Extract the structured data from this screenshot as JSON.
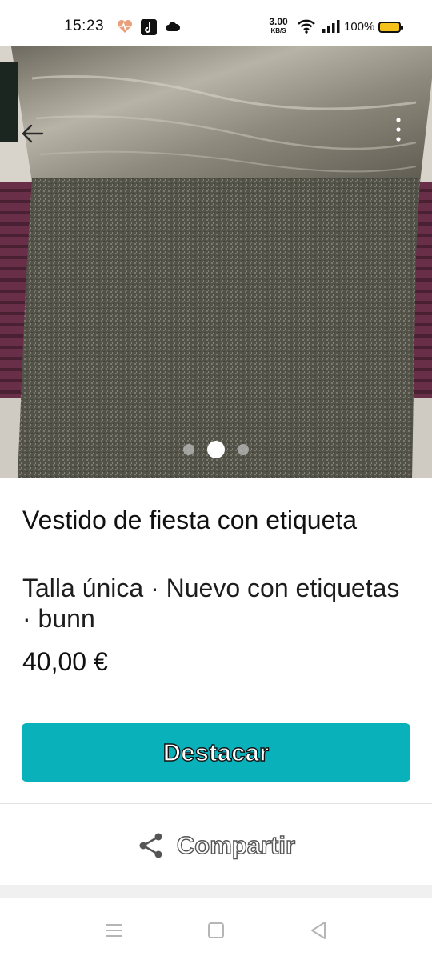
{
  "status_bar": {
    "time": "15:23",
    "net_speed_value": "3.00",
    "net_speed_unit": "KB/S",
    "battery": "100%",
    "icons": [
      "heart-monitor-icon",
      "music-app-icon",
      "cloud-icon",
      "wifi-icon",
      "signal-icon",
      "battery-icon"
    ]
  },
  "photo": {
    "carousel": {
      "count": 3,
      "active_index": 1
    },
    "icons": [
      "back-arrow-icon",
      "more-vertical-icon"
    ]
  },
  "product": {
    "title": "Vestido de fiesta con etiqueta",
    "meta": "Talla única · Nuevo con etiquetas · bunn",
    "price": "40,00 €"
  },
  "actions": {
    "highlight_label": "Destacar",
    "share_label": "Compartir"
  },
  "nav_bar": {
    "icons": [
      "menu-icon",
      "home-icon",
      "back-icon"
    ]
  },
  "colors": {
    "accent": "#09b1ba",
    "battery": "#f4c21b",
    "fabric_top": "#8a8678",
    "fabric_bottom": "#4a4a42"
  }
}
